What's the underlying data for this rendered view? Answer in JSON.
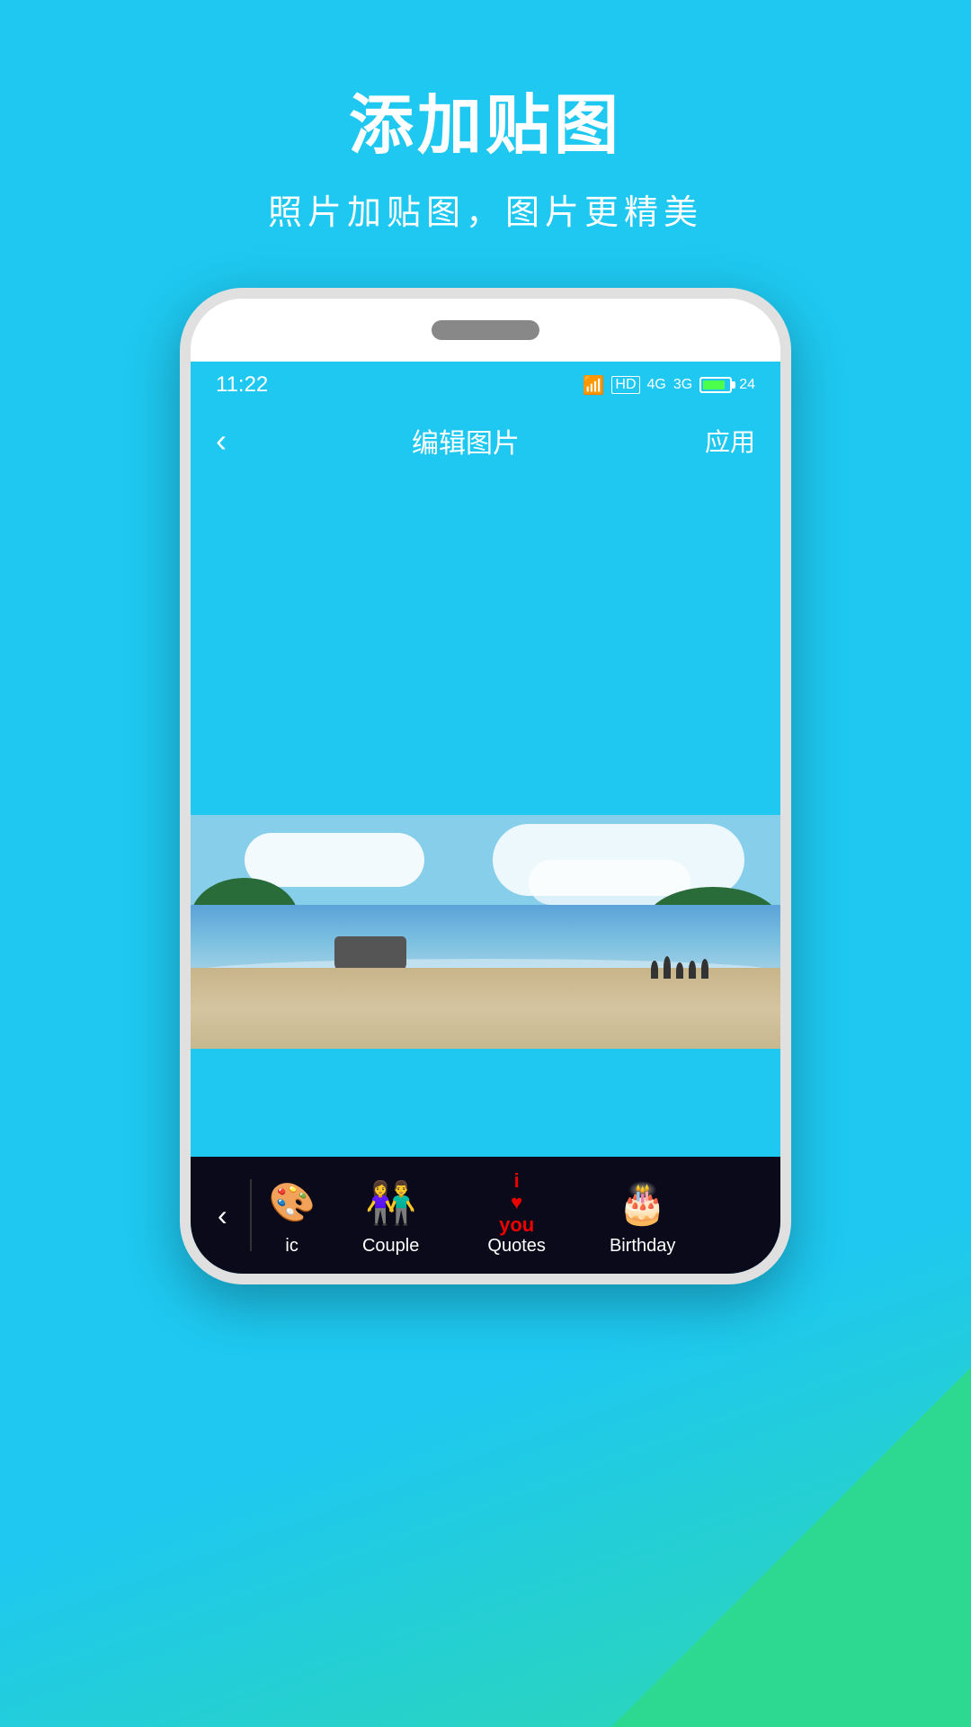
{
  "background": {
    "primary_color": "#1ec8f0",
    "accent_color": "#2dd890"
  },
  "header": {
    "title": "添加贴图",
    "subtitle": "照片加贴图，图片更精美"
  },
  "phone": {
    "status_bar": {
      "time": "11:22",
      "wifi_icon": "wifi",
      "signal_icons": "HD 4G 3G",
      "battery": "24"
    },
    "nav": {
      "back_icon": "‹",
      "title": "编辑图片",
      "action": "应用"
    }
  },
  "toolbar": {
    "back_icon": "‹",
    "items": [
      {
        "id": "ic",
        "label": "ic",
        "icon": "🎨"
      },
      {
        "id": "couple",
        "label": "Couple",
        "icon": "👫"
      },
      {
        "id": "quotes",
        "label": "Quotes",
        "icon": "💕"
      },
      {
        "id": "birthday",
        "label": "Birthday",
        "icon": "🎂"
      }
    ]
  }
}
